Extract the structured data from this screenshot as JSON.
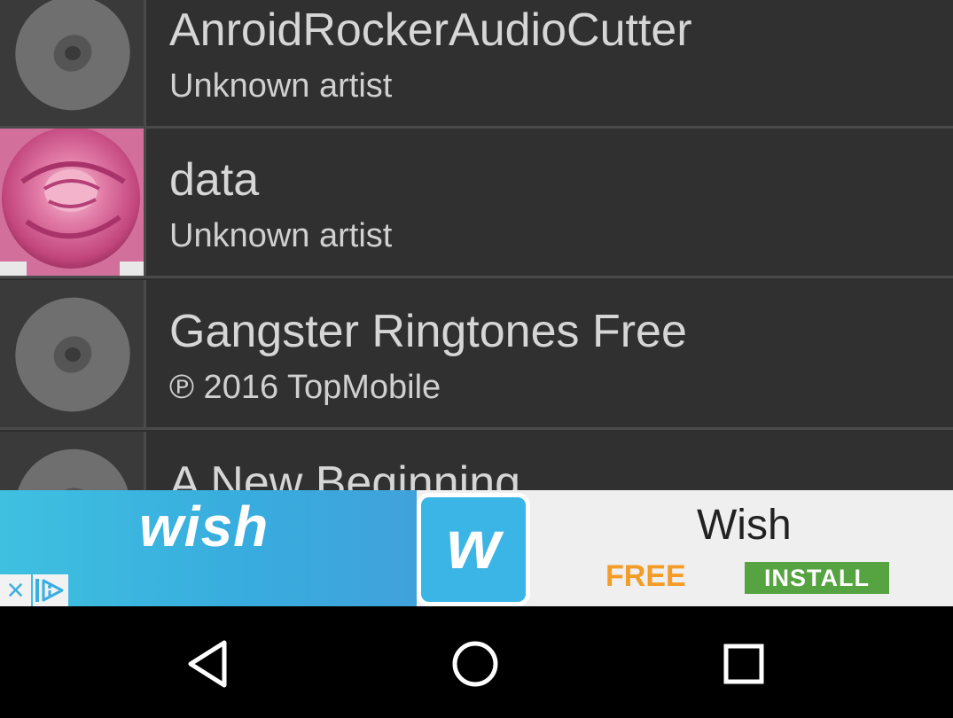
{
  "tracks": [
    {
      "title": "AnroidRockerAudioCutter",
      "subtitle": "Unknown artist",
      "art": "disc-icon"
    },
    {
      "title": "data",
      "subtitle": "Unknown artist",
      "art": "album-art-rose"
    },
    {
      "title": "Gangster Ringtones Free",
      "subtitle": "℗ 2016 TopMobile",
      "art": "disc-icon"
    },
    {
      "title": "A New Beginning",
      "subtitle": "",
      "art": "disc-icon"
    }
  ],
  "ad": {
    "brand": "wish",
    "logo_glyph": "w",
    "app_name": "Wish",
    "price": "FREE",
    "install_label": "INSTALL",
    "close_glyph": "×"
  },
  "nav": {
    "back": "back-icon",
    "home": "home-icon",
    "recents": "recents-icon"
  },
  "colors": {
    "list_bg": "#303030",
    "install_green": "#55a341",
    "free_orange": "#f39c28",
    "wish_blue": "#3ab5e6"
  }
}
